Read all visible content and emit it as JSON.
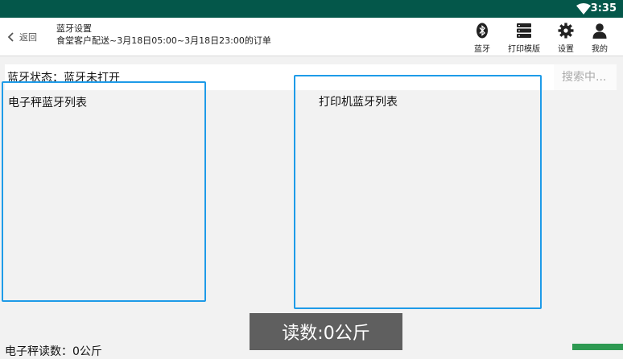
{
  "status_bar": {
    "time": "3:35"
  },
  "header": {
    "back_label": "返回",
    "title": "蓝牙设置",
    "subtitle": "食堂客户配送~3月18日05:00~3月18日23:00的订单"
  },
  "toolbar": {
    "bluetooth": "蓝牙",
    "print_template": "打印模版",
    "settings": "设置",
    "mine": "我的"
  },
  "bluetooth_status": "蓝牙状态：蓝牙未打开",
  "search": {
    "placeholder": "搜索中..."
  },
  "scale_list_title": "电子秤蓝牙列表",
  "printer_list_title": "打印机蓝牙列表",
  "scale_reading_label": "电子秤读数：0公斤",
  "toast": "读数:0公斤",
  "colors": {
    "status_bar": "#04574a",
    "accent_border": "#1e9be8",
    "green_button": "#2e9a52"
  }
}
